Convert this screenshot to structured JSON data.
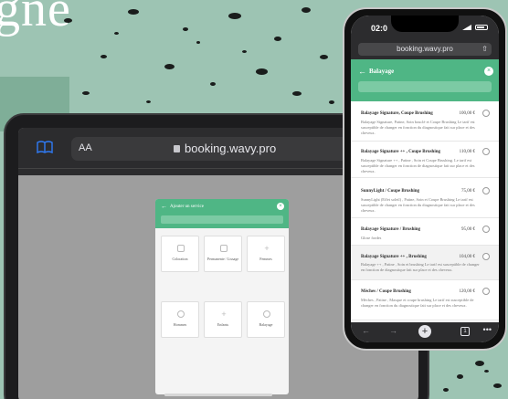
{
  "background": {
    "headline": "gne",
    "accent": "#4fb685"
  },
  "tablet": {
    "browser": {
      "reader_icon": "book-icon",
      "text_size": "AA",
      "url": "booking.wavy.pro"
    },
    "modal": {
      "title": "Ajouter un service",
      "categories": [
        {
          "label": "Coloration",
          "icon": "color-icon"
        },
        {
          "label": "Permanente / Lissage",
          "icon": "perm-icon"
        },
        {
          "label": "Femmes",
          "icon": "plus-icon"
        },
        {
          "label": "Hommes",
          "icon": "face-icon"
        },
        {
          "label": "Enfants",
          "icon": "plus-icon"
        },
        {
          "label": "Balayage",
          "icon": "balayage-icon"
        }
      ]
    }
  },
  "phone": {
    "status": {
      "time": "02:0"
    },
    "browser": {
      "url": "booking.wavy.pro",
      "tab_count": "1"
    },
    "header": {
      "title": "Balayage"
    },
    "services": [
      {
        "name": "Balayage Signature, Coupe Brushing",
        "price": "100,00 €",
        "desc": "Balayage Signature, Patine, Soin bouclé et Coupe Brushing Le tarif est susceptible de changer en fonction du diagnostique fait sur place et des cheveux."
      },
      {
        "name": "Balayage Signature ++ , Coupe Brushing",
        "price": "110,00 €",
        "desc": "Balayage Signature ++ , Patine , Soin et Coupe Brushing. Le tarif est susceptible de changer en fonction de diagnostique fait sur place et des cheveux."
      },
      {
        "name": "SunnyLight / Coupe Brushing",
        "price": "75,00 €",
        "desc": "SunnyLight (Effet soleil) , Patine, Soin et Coupe Brushing Le tarif est susceptible de changer en fonction du diagnostique fait sur place et des cheveux."
      },
      {
        "name": "Balayage Signature / Brushing",
        "price": "95,00 €",
        "desc": "Glose fordes"
      },
      {
        "name": "Balayage Signature ++ , Brushing",
        "price": "104,00 €",
        "desc": "Balayage ++ , Patine , Soin et brushing Le tarif est susceptible de changer en fonction de diagnostique fait sur place et des cheveux."
      },
      {
        "name": "Mèches / Coupe Brushing",
        "price": "120,00 €",
        "desc": "Mèches , Patine , Masque et coupe brushing Le tarif est susceptible de changer en fonction du diagnostique fait sur place et des cheveux."
      }
    ]
  }
}
